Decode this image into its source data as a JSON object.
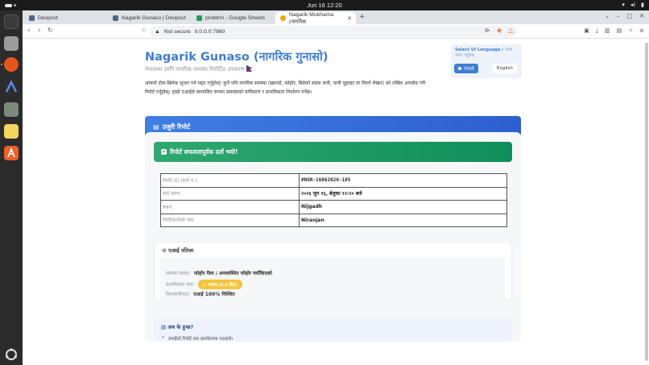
{
  "system": {
    "clock": "Jun 16  12:20"
  },
  "browser": {
    "tabs": [
      {
        "label": "Devpost",
        "favicon_color": "#4a6a86"
      },
      {
        "label": "Nagarik Gunaso | Devpost",
        "favicon_color": "#4a6a86"
      },
      {
        "label": "problrm - Google Sheets",
        "favicon_color": "#1e9e58"
      },
      {
        "label": "Nagarik Mukhama (नागरिक",
        "favicon_color": "#f0a400"
      }
    ],
    "url_security": "Not secure",
    "url": "0.0.0.0:7860"
  },
  "page": {
    "title": "Nagarik Gunaso (नागरिक गुनासो)",
    "subtitle": "नेपालका लागि नागरिक समस्या रिपोर्टिङ उपकरण",
    "description": "आफ्नो टोल-छिमेक सुधार गर्न मद्दत गर्नुहोस्! कुनै पनि नागरिक समस्या (खाल्डो, फोहोर, बिग्रेको सडक बत्ती, पानी चुहावट वा मिल्ने लेखन) को तस्बिर अपलोड गरी रिपोर्ट गर्नुहोस्। हाम्रो एआईले स्वचालित रूपमा समस्याको वर्गीकरण र प्राथमिकता निर्धारण गर्नेछ।",
    "language": {
      "label": "Select UI Language /",
      "label_muted": "भाषा चयन गर्नुहोस्",
      "options": [
        {
          "label": "नेपाली",
          "selected": true
        },
        {
          "label": "English",
          "selected": false
        }
      ]
    },
    "report_header": "उजुरी रिपोर्ट",
    "success_message": "रिपोर्ट सफलतापूर्वक दर्ता भयो!",
    "info_table": [
      {
        "key": "रिपोर्ट ID (दर्ता नं.):",
        "value": "#NGR-16062026-185",
        "mono": true
      },
      {
        "key": "दर्ता समय:",
        "value": "२०२६ जुन १६, बेलुका १२:२० बजे",
        "mono": false
      },
      {
        "key": "स्थान:",
        "value": "Nijgadh",
        "mono": false
      },
      {
        "key": "रिपोर्टकर्ताको नाम:",
        "value": "Niranjan",
        "mono": false
      }
    ],
    "ai_result": {
      "heading": "एआई नतिजा",
      "rows": [
        {
          "key": "समस्या प्रकार:",
          "value": "फोहोर मैला / अव्यवस्थित फोहोर फ्याँकिएको"
        },
        {
          "key": "प्राथमिकता स्तर:",
          "badge": "मध्यम (३-७ दिन)"
        },
        {
          "key": "विश्वसनीयता:",
          "value": "एआई 100% निश्चित"
        }
      ]
    },
    "next_steps": {
      "heading": "अब के हुन्छ?",
      "items": [
        "तपाईंको रिपोर्ट वडा कार्यालयमा पठाइयो।"
      ]
    }
  },
  "colors": {
    "accent": "#3d7fd1",
    "success": "#1a9a62",
    "badge": "#f6c53b"
  }
}
